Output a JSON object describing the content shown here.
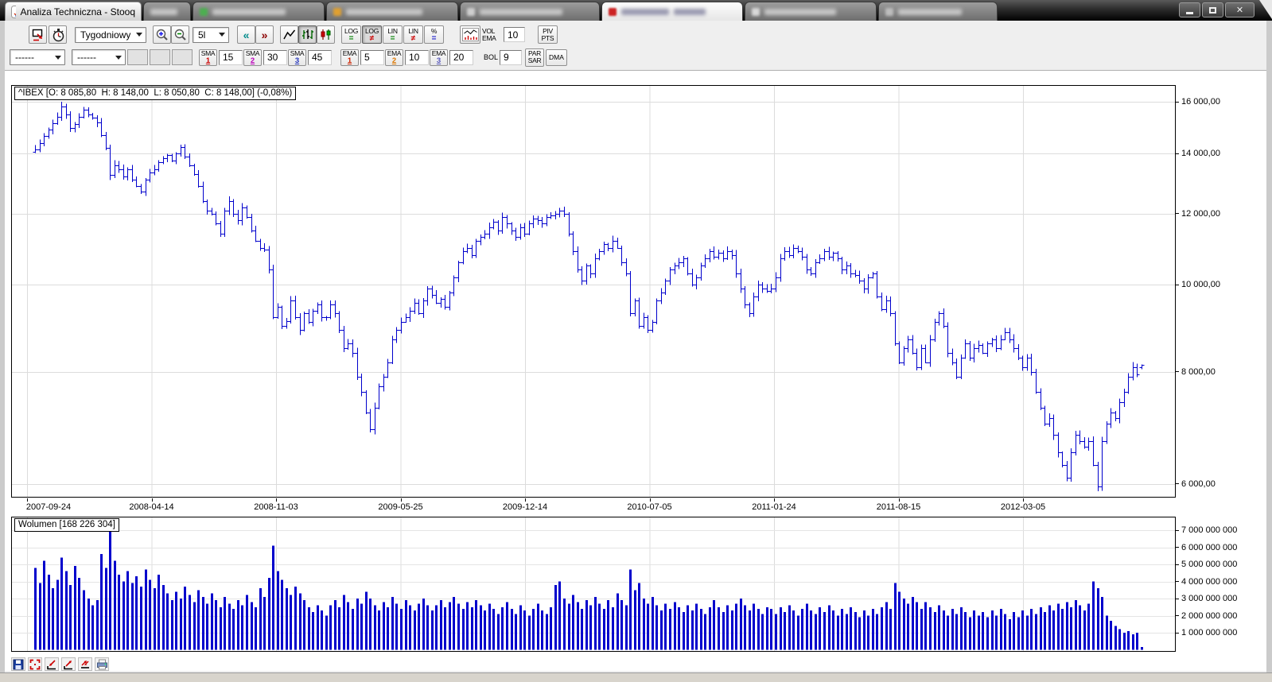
{
  "window": {
    "title": "Analiza Techniczna - Stooq"
  },
  "titlebar": {
    "window_buttons": [
      "minimize-icon",
      "maximize-icon",
      "close-icon"
    ]
  },
  "toolbar1": {
    "interval_value": "Tygodniowy",
    "range_value": "5l",
    "back_label": "«",
    "forward_label": "»",
    "back_color": "#008b8b",
    "forward_color": "#8b0000",
    "scale_buttons": [
      {
        "line1": "LOG",
        "line2": "=",
        "color": "#008000",
        "pressed": false
      },
      {
        "line1": "LOG",
        "line2": "≠",
        "color": "#cc0000",
        "pressed": true
      },
      {
        "line1": "LIN",
        "line2": "=",
        "color": "#008000",
        "pressed": false
      },
      {
        "line1": "LIN",
        "line2": "≠",
        "color": "#cc0000",
        "pressed": false
      },
      {
        "line1": "%",
        "line2": "=",
        "color": "#2222cc",
        "pressed": false
      }
    ],
    "vol_label": {
      "line1": "VOL",
      "line2": "EMA"
    },
    "vol_ema_value": "10",
    "piv_label": {
      "line1": "PIV",
      "line2": "PTS"
    },
    "icons": [
      "new-window-icon",
      "stopwatch-icon",
      "zoom-in-icon",
      "zoom-out-icon",
      "line-type-icon",
      "ohlc-type-icon",
      "candle-type-icon",
      "volume-style-icon"
    ]
  },
  "toolbar2": {
    "combo1_value": "------",
    "combo2_value": "------",
    "indicators": [
      {
        "label": "SMA",
        "num": "1",
        "num_color": "#cc0000",
        "value": "15"
      },
      {
        "label": "SMA",
        "num": "2",
        "num_color": "#bb00bb",
        "value": "30"
      },
      {
        "label": "SMA",
        "num": "3",
        "num_color": "#2233bb",
        "value": "45"
      },
      {
        "label": "EMA",
        "num": "1",
        "num_color": "#cc2200",
        "value": "5"
      },
      {
        "label": "EMA",
        "num": "2",
        "num_color": "#dd7700",
        "value": "10"
      },
      {
        "label": "EMA",
        "num": "3",
        "num_color": "#5555bb",
        "value": "20"
      }
    ],
    "bol_label": "BOL",
    "bol_value": "9",
    "parsar_label": {
      "line1": "PAR",
      "line2": "SAR"
    },
    "dma_label": "DMA"
  },
  "price_chart": {
    "symbol_text": "^IBEX [O: 8 085,80  H: 8 148,00  L: 8 050,80  C: 8 148,00] (-0,08%)",
    "y_tick_labels": [
      "16 000,00",
      "14 000,00",
      "12 000,00",
      "10 000,00",
      "8 000,00",
      "6 000,00"
    ]
  },
  "volume_chart": {
    "label_text": "Wolumen [168 226 304]",
    "y_tick_labels": [
      "7 000 000 000",
      "6 000 000 000",
      "5 000 000 000",
      "4 000 000 000",
      "3 000 000 000",
      "2 000 000 000",
      "1 000 000 000"
    ]
  },
  "bottom_toolbar": {
    "icons": [
      "save-icon",
      "zoom-window-icon",
      "import-icon",
      "export-icon",
      "transfer-icon",
      "print-icon"
    ]
  },
  "chart_data": [
    {
      "type": "ohlc-bar",
      "title": "^IBEX weekly (Tygodniowy, 5l)",
      "scale": "log",
      "bar_color": "#0000cc",
      "grid": true,
      "x_tick_labels": [
        "2007-09-24",
        "2008-04-14",
        "2008-11-03",
        "2009-05-25",
        "2009-12-14",
        "2010-07-05",
        "2011-01-24",
        "2011-08-15",
        "2012-03-05"
      ],
      "y_tick_values": [
        16000,
        14000,
        12000,
        10000,
        8000,
        6000
      ],
      "ylim": [
        5790,
        16700
      ],
      "last_bar": {
        "open": 8085.8,
        "high": 8148.0,
        "low": 8050.8,
        "close": 8148.0,
        "change_pct": -0.08
      },
      "closes": [
        14150,
        14400,
        14650,
        14900,
        15150,
        15400,
        15800,
        15500,
        14950,
        15100,
        15400,
        15680,
        15500,
        15350,
        15182,
        14700,
        14200,
        13250,
        13600,
        13450,
        13200,
        13450,
        13100,
        12900,
        12700,
        13100,
        13350,
        13450,
        13700,
        13850,
        13950,
        13750,
        14000,
        14250,
        13900,
        13600,
        13300,
        12900,
        12400,
        12100,
        12000,
        11700,
        11400,
        12100,
        12400,
        12000,
        11800,
        12200,
        11900,
        11500,
        11200,
        11000,
        10950,
        10400,
        9200,
        9450,
        9000,
        9116,
        9600,
        9200,
        8900,
        9300,
        9100,
        9350,
        9500,
        9200,
        9195,
        9500,
        9300,
        8900,
        8500,
        8600,
        8400,
        7900,
        7600,
        7200,
        6900,
        7300,
        7700,
        7900,
        8200,
        8700,
        8900,
        9100,
        9200,
        9350,
        9550,
        9300,
        9600,
        9900,
        9750,
        9550,
        9650,
        9450,
        9800,
        10200,
        10600,
        10900,
        11000,
        10800,
        11200,
        11300,
        11400,
        11600,
        11750,
        11500,
        11900,
        11700,
        11500,
        11300,
        11600,
        11400,
        11700,
        11850,
        11800,
        11700,
        11900,
        11940,
        12000,
        12100,
        12000,
        11400,
        10900,
        10400,
        10100,
        10500,
        10300,
        10700,
        10900,
        11100,
        11000,
        11200,
        11000,
        10600,
        10300,
        9300,
        9600,
        9000,
        9200,
        8900,
        9100,
        9600,
        9800,
        10100,
        10400,
        10500,
        10600,
        10700,
        10300,
        10000,
        10200,
        10500,
        10700,
        10900,
        10750,
        10850,
        10700,
        10900,
        10800,
        10300,
        9900,
        9500,
        9300,
        9700,
        10000,
        9900,
        9850,
        9900,
        10200,
        10700,
        10900,
        10800,
        11000,
        10900,
        10750,
        10400,
        10300,
        10600,
        10700,
        10900,
        10750,
        10850,
        10700,
        10400,
        10500,
        10300,
        10250,
        10100,
        9900,
        10200,
        10300,
        9700,
        9400,
        9600,
        9300,
        8600,
        8200,
        8500,
        8700,
        8400,
        8100,
        8500,
        8200,
        8700,
        9100,
        9300,
        9000,
        8400,
        8200,
        7900,
        8300,
        8600,
        8300,
        8500,
        8570,
        8400,
        8600,
        8700,
        8500,
        8700,
        8850,
        8700,
        8500,
        8300,
        8100,
        8300,
        8000,
        7600,
        7300,
        7000,
        7100,
        6800,
        6500,
        6300,
        6100,
        6500,
        6800,
        6700,
        6600,
        6700,
        6300,
        5960,
        6700,
        7000,
        7200,
        7100,
        7400,
        7600,
        7900,
        8100,
        7950,
        8148
      ]
    },
    {
      "type": "bar",
      "title": "Wolumen",
      "bar_color": "#0000cc",
      "unit": 1000000,
      "last_value": 168226304,
      "y_tick_values": [
        7000000000,
        6000000000,
        5000000000,
        4000000000,
        3000000000,
        2000000000,
        1000000000
      ],
      "values_millions": [
        4800,
        3900,
        5200,
        4400,
        3600,
        4100,
        5400,
        4600,
        3800,
        4900,
        4200,
        3500,
        3000,
        2600,
        2900,
        5600,
        4800,
        7300,
        5200,
        4400,
        4000,
        4600,
        3900,
        4300,
        3700,
        4700,
        4100,
        3600,
        4400,
        3800,
        3300,
        2900,
        3400,
        3000,
        3700,
        3200,
        2800,
        3500,
        3100,
        2700,
        3300,
        2900,
        2500,
        3100,
        2700,
        2400,
        2900,
        2600,
        3200,
        2800,
        2500,
        3600,
        3100,
        4200,
        6100,
        4600,
        4100,
        3600,
        3200,
        3700,
        3300,
        2900,
        2500,
        2200,
        2600,
        2300,
        2000,
        2600,
        2900,
        2500,
        3200,
        2800,
        2400,
        3000,
        2700,
        3400,
        3000,
        2600,
        2300,
        2800,
        2500,
        3100,
        2700,
        2400,
        2900,
        2600,
        2300,
        2700,
        3000,
        2600,
        2300,
        2600,
        2900,
        2500,
        2800,
        3100,
        2700,
        2400,
        2800,
        2500,
        2900,
        2600,
        2300,
        2700,
        2400,
        2100,
        2500,
        2800,
        2400,
        2100,
        2600,
        2300,
        2000,
        2400,
        2700,
        2300,
        2100,
        2500,
        3800,
        4000,
        3000,
        2700,
        3200,
        2800,
        2400,
        2900,
        2600,
        3100,
        2700,
        2400,
        2900,
        2500,
        3300,
        2900,
        2600,
        4700,
        3500,
        3900,
        3000,
        2700,
        3100,
        2600,
        2300,
        2700,
        2400,
        2800,
        2500,
        2200,
        2600,
        2300,
        2700,
        2400,
        2100,
        2500,
        2900,
        2500,
        2200,
        2600,
        2300,
        2700,
        3000,
        2600,
        2300,
        2700,
        2400,
        2100,
        2500,
        2400,
        2100,
        2500,
        2200,
        2600,
        2300,
        2000,
        2400,
        2700,
        2300,
        2100,
        2500,
        2200,
        2600,
        2300,
        2000,
        2400,
        2100,
        2500,
        2200,
        1900,
        2300,
        2000,
        2400,
        2100,
        2500,
        2800,
        2400,
        3900,
        3400,
        3000,
        2700,
        3100,
        2800,
        2400,
        2800,
        2500,
        2200,
        2600,
        2300,
        2000,
        2400,
        2100,
        2500,
        2200,
        1900,
        2300,
        2000,
        2200,
        1900,
        2300,
        2000,
        2400,
        2100,
        1800,
        2200,
        1900,
        2300,
        2000,
        2400,
        2100,
        2500,
        2200,
        2600,
        2300,
        2700,
        2400,
        2800,
        2500,
        2900,
        2600,
        2300,
        2700,
        4000,
        3600,
        3100,
        2000,
        1700,
        1400,
        1200,
        1000,
        1100,
        900,
        1000,
        168
      ]
    }
  ]
}
